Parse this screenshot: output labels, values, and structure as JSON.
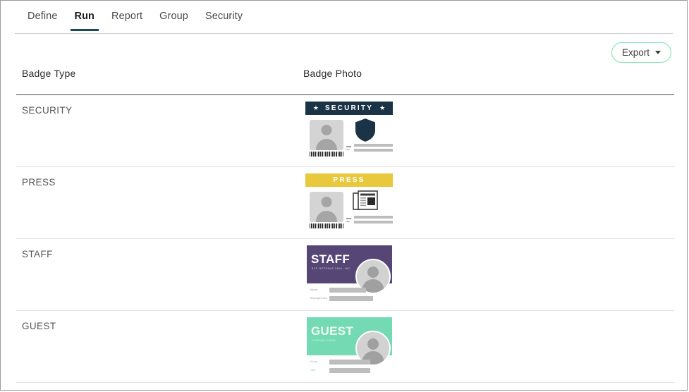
{
  "tabs": [
    {
      "label": "Define",
      "active": false
    },
    {
      "label": "Run",
      "active": true
    },
    {
      "label": "Report",
      "active": false
    },
    {
      "label": "Group",
      "active": false
    },
    {
      "label": "Security",
      "active": false
    }
  ],
  "toolbar": {
    "export_label": "Export",
    "caret_icon": "caret-down-icon"
  },
  "table": {
    "columns": [
      "Badge Type",
      "Badge Photo"
    ],
    "rows": [
      {
        "badge_type": "SECURITY",
        "badge": {
          "style": "idcard",
          "header_text": "SECURITY",
          "header_color": "#1b3347",
          "header_text_color": "#ffffff",
          "left_star": "★",
          "right_star": "★",
          "icon": "shield-icon",
          "icon_color": "#1b3347",
          "has_photo_placeholder": true,
          "has_barcode": true
        }
      },
      {
        "badge_type": "PRESS",
        "badge": {
          "style": "idcard",
          "header_text": "PRESS",
          "header_color": "#e8c83c",
          "header_text_color": "#ffffff",
          "left_star": "",
          "right_star": "",
          "icon": "newspaper-icon",
          "icon_color": "#3d3d3d",
          "has_photo_placeholder": true,
          "has_barcode": true
        }
      },
      {
        "badge_type": "STAFF",
        "badge": {
          "style": "hcard",
          "title": "STAFF",
          "subtitle": "BCS INTERNATIONAL, INC.",
          "band_color": "#554676",
          "title_color": "#ffffff",
          "field_labels": [
            "Name:",
            "Employee No.:"
          ],
          "avatar_icon": "user-avatar-icon"
        }
      },
      {
        "badge_type": "GUEST",
        "badge": {
          "style": "hcard",
          "title": "GUEST",
          "subtitle": "COMPANY NAME",
          "band_color": "#74dab3",
          "title_color": "#f1fbf6",
          "field_labels": [
            "Name:",
            "Title:"
          ],
          "avatar_icon": "user-avatar-icon"
        }
      }
    ]
  },
  "theme": {
    "accent_underline": "#1b4a5a",
    "export_border": "#7fe0b2",
    "header_rule": "#4a4a4a",
    "row_rule": "#e2e2e2"
  }
}
